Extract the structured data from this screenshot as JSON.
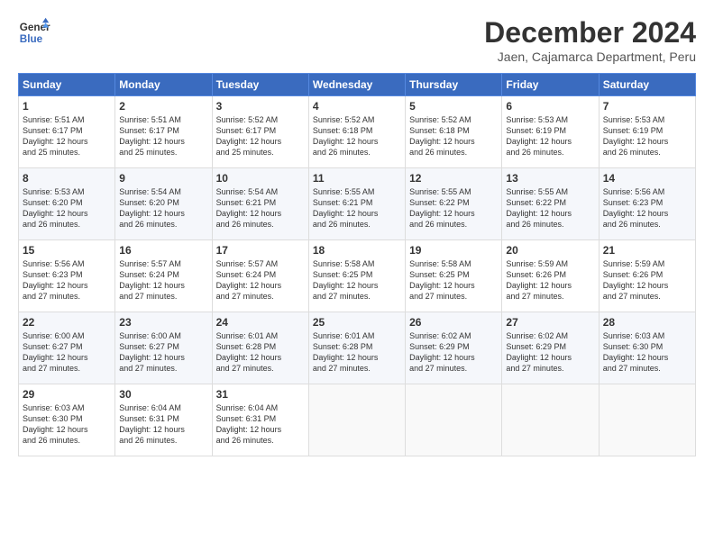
{
  "logo": {
    "line1": "General",
    "line2": "Blue"
  },
  "title": "December 2024",
  "subtitle": "Jaen, Cajamarca Department, Peru",
  "header_days": [
    "Sunday",
    "Monday",
    "Tuesday",
    "Wednesday",
    "Thursday",
    "Friday",
    "Saturday"
  ],
  "weeks": [
    [
      {
        "day": "1",
        "info": "Sunrise: 5:51 AM\nSunset: 6:17 PM\nDaylight: 12 hours\nand 25 minutes."
      },
      {
        "day": "2",
        "info": "Sunrise: 5:51 AM\nSunset: 6:17 PM\nDaylight: 12 hours\nand 25 minutes."
      },
      {
        "day": "3",
        "info": "Sunrise: 5:52 AM\nSunset: 6:17 PM\nDaylight: 12 hours\nand 25 minutes."
      },
      {
        "day": "4",
        "info": "Sunrise: 5:52 AM\nSunset: 6:18 PM\nDaylight: 12 hours\nand 26 minutes."
      },
      {
        "day": "5",
        "info": "Sunrise: 5:52 AM\nSunset: 6:18 PM\nDaylight: 12 hours\nand 26 minutes."
      },
      {
        "day": "6",
        "info": "Sunrise: 5:53 AM\nSunset: 6:19 PM\nDaylight: 12 hours\nand 26 minutes."
      },
      {
        "day": "7",
        "info": "Sunrise: 5:53 AM\nSunset: 6:19 PM\nDaylight: 12 hours\nand 26 minutes."
      }
    ],
    [
      {
        "day": "8",
        "info": "Sunrise: 5:53 AM\nSunset: 6:20 PM\nDaylight: 12 hours\nand 26 minutes."
      },
      {
        "day": "9",
        "info": "Sunrise: 5:54 AM\nSunset: 6:20 PM\nDaylight: 12 hours\nand 26 minutes."
      },
      {
        "day": "10",
        "info": "Sunrise: 5:54 AM\nSunset: 6:21 PM\nDaylight: 12 hours\nand 26 minutes."
      },
      {
        "day": "11",
        "info": "Sunrise: 5:55 AM\nSunset: 6:21 PM\nDaylight: 12 hours\nand 26 minutes."
      },
      {
        "day": "12",
        "info": "Sunrise: 5:55 AM\nSunset: 6:22 PM\nDaylight: 12 hours\nand 26 minutes."
      },
      {
        "day": "13",
        "info": "Sunrise: 5:55 AM\nSunset: 6:22 PM\nDaylight: 12 hours\nand 26 minutes."
      },
      {
        "day": "14",
        "info": "Sunrise: 5:56 AM\nSunset: 6:23 PM\nDaylight: 12 hours\nand 26 minutes."
      }
    ],
    [
      {
        "day": "15",
        "info": "Sunrise: 5:56 AM\nSunset: 6:23 PM\nDaylight: 12 hours\nand 27 minutes."
      },
      {
        "day": "16",
        "info": "Sunrise: 5:57 AM\nSunset: 6:24 PM\nDaylight: 12 hours\nand 27 minutes."
      },
      {
        "day": "17",
        "info": "Sunrise: 5:57 AM\nSunset: 6:24 PM\nDaylight: 12 hours\nand 27 minutes."
      },
      {
        "day": "18",
        "info": "Sunrise: 5:58 AM\nSunset: 6:25 PM\nDaylight: 12 hours\nand 27 minutes."
      },
      {
        "day": "19",
        "info": "Sunrise: 5:58 AM\nSunset: 6:25 PM\nDaylight: 12 hours\nand 27 minutes."
      },
      {
        "day": "20",
        "info": "Sunrise: 5:59 AM\nSunset: 6:26 PM\nDaylight: 12 hours\nand 27 minutes."
      },
      {
        "day": "21",
        "info": "Sunrise: 5:59 AM\nSunset: 6:26 PM\nDaylight: 12 hours\nand 27 minutes."
      }
    ],
    [
      {
        "day": "22",
        "info": "Sunrise: 6:00 AM\nSunset: 6:27 PM\nDaylight: 12 hours\nand 27 minutes."
      },
      {
        "day": "23",
        "info": "Sunrise: 6:00 AM\nSunset: 6:27 PM\nDaylight: 12 hours\nand 27 minutes."
      },
      {
        "day": "24",
        "info": "Sunrise: 6:01 AM\nSunset: 6:28 PM\nDaylight: 12 hours\nand 27 minutes."
      },
      {
        "day": "25",
        "info": "Sunrise: 6:01 AM\nSunset: 6:28 PM\nDaylight: 12 hours\nand 27 minutes."
      },
      {
        "day": "26",
        "info": "Sunrise: 6:02 AM\nSunset: 6:29 PM\nDaylight: 12 hours\nand 27 minutes."
      },
      {
        "day": "27",
        "info": "Sunrise: 6:02 AM\nSunset: 6:29 PM\nDaylight: 12 hours\nand 27 minutes."
      },
      {
        "day": "28",
        "info": "Sunrise: 6:03 AM\nSunset: 6:30 PM\nDaylight: 12 hours\nand 27 minutes."
      }
    ],
    [
      {
        "day": "29",
        "info": "Sunrise: 6:03 AM\nSunset: 6:30 PM\nDaylight: 12 hours\nand 26 minutes."
      },
      {
        "day": "30",
        "info": "Sunrise: 6:04 AM\nSunset: 6:31 PM\nDaylight: 12 hours\nand 26 minutes."
      },
      {
        "day": "31",
        "info": "Sunrise: 6:04 AM\nSunset: 6:31 PM\nDaylight: 12 hours\nand 26 minutes."
      },
      {
        "day": "",
        "info": ""
      },
      {
        "day": "",
        "info": ""
      },
      {
        "day": "",
        "info": ""
      },
      {
        "day": "",
        "info": ""
      }
    ]
  ]
}
